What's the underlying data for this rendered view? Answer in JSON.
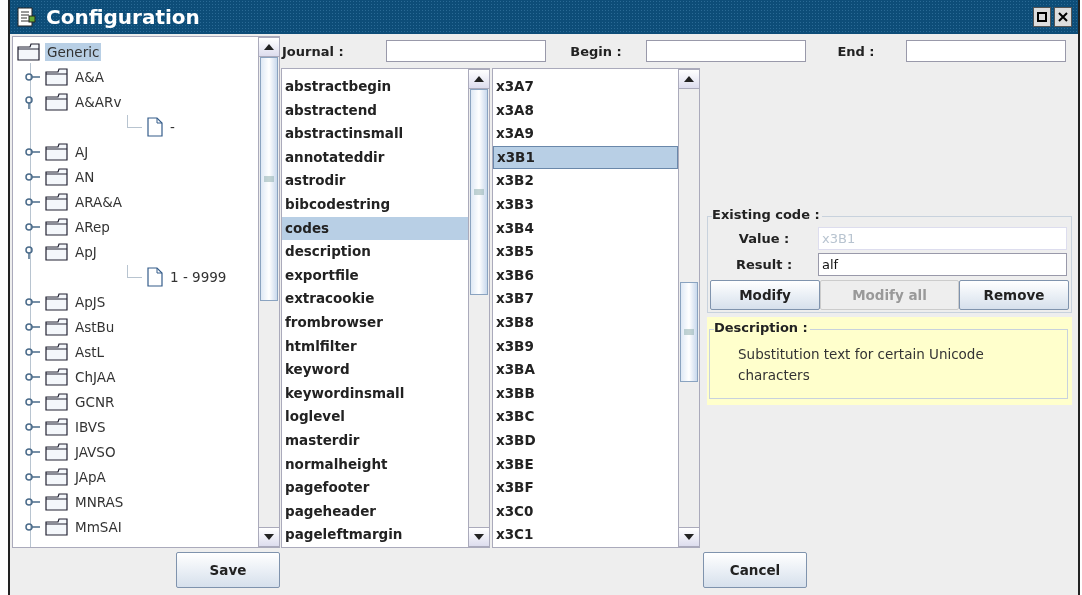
{
  "window": {
    "title": "Configuration"
  },
  "tree": {
    "label": "Generic",
    "kind": "folder",
    "selected": true,
    "children": [
      {
        "label": "A&A",
        "kind": "folder",
        "selected": false,
        "expanded": false
      },
      {
        "label": "A&ARv",
        "kind": "folder",
        "selected": false,
        "expanded": true,
        "children": [
          {
            "label": "-",
            "kind": "file",
            "selected": false
          }
        ]
      },
      {
        "label": "AJ",
        "kind": "folder",
        "selected": false,
        "expanded": false
      },
      {
        "label": "AN",
        "kind": "folder",
        "selected": false,
        "expanded": false
      },
      {
        "label": "ARA&A",
        "kind": "folder",
        "selected": false,
        "expanded": false
      },
      {
        "label": "ARep",
        "kind": "folder",
        "selected": false,
        "expanded": false
      },
      {
        "label": "ApJ",
        "kind": "folder",
        "selected": false,
        "expanded": true,
        "children": [
          {
            "label": "1 - 9999",
            "kind": "file",
            "selected": false
          }
        ]
      },
      {
        "label": "ApJS",
        "kind": "folder",
        "selected": false,
        "expanded": false
      },
      {
        "label": "AstBu",
        "kind": "folder",
        "selected": false,
        "expanded": false
      },
      {
        "label": "AstL",
        "kind": "folder",
        "selected": false,
        "expanded": false
      },
      {
        "label": "ChJAA",
        "kind": "folder",
        "selected": false,
        "expanded": false
      },
      {
        "label": "GCNR",
        "kind": "folder",
        "selected": false,
        "expanded": false
      },
      {
        "label": "IBVS",
        "kind": "folder",
        "selected": false,
        "expanded": false
      },
      {
        "label": "JAVSO",
        "kind": "folder",
        "selected": false,
        "expanded": false
      },
      {
        "label": "JApA",
        "kind": "folder",
        "selected": false,
        "expanded": false
      },
      {
        "label": "MNRAS",
        "kind": "folder",
        "selected": false,
        "expanded": false
      },
      {
        "label": "MmSAI",
        "kind": "folder",
        "selected": false,
        "expanded": false
      }
    ]
  },
  "filters": [
    {
      "label": "Journal :"
    },
    {
      "label": "Begin :"
    },
    {
      "label": "End :"
    }
  ],
  "keys": [
    {
      "label": "abstractbegin",
      "selected": false
    },
    {
      "label": "abstractend",
      "selected": false
    },
    {
      "label": "abstractinsmall",
      "selected": false
    },
    {
      "label": "annotateddir",
      "selected": false
    },
    {
      "label": "astrodir",
      "selected": false
    },
    {
      "label": "bibcodestring",
      "selected": false
    },
    {
      "label": "codes",
      "selected": true
    },
    {
      "label": "description",
      "selected": false
    },
    {
      "label": "exportfile",
      "selected": false
    },
    {
      "label": "extracookie",
      "selected": false
    },
    {
      "label": "frombrowser",
      "selected": false
    },
    {
      "label": "htmlfilter",
      "selected": false
    },
    {
      "label": "keyword",
      "selected": false
    },
    {
      "label": "keywordinsmall",
      "selected": false
    },
    {
      "label": "loglevel",
      "selected": false
    },
    {
      "label": "masterdir",
      "selected": false
    },
    {
      "label": "normalheight",
      "selected": false
    },
    {
      "label": "pagefooter",
      "selected": false
    },
    {
      "label": "pageheader",
      "selected": false
    },
    {
      "label": "pageleftmargin",
      "selected": false
    }
  ],
  "codes": [
    {
      "label": "x3A7",
      "selected": false
    },
    {
      "label": "x3A8",
      "selected": false
    },
    {
      "label": "x3A9",
      "selected": false
    },
    {
      "label": "x3B1",
      "selected": true
    },
    {
      "label": "x3B2",
      "selected": false
    },
    {
      "label": "x3B3",
      "selected": false
    },
    {
      "label": "x3B4",
      "selected": false
    },
    {
      "label": "x3B5",
      "selected": false
    },
    {
      "label": "x3B6",
      "selected": false
    },
    {
      "label": "x3B7",
      "selected": false
    },
    {
      "label": "x3B8",
      "selected": false
    },
    {
      "label": "x3B9",
      "selected": false
    },
    {
      "label": "x3BA",
      "selected": false
    },
    {
      "label": "x3BB",
      "selected": false
    },
    {
      "label": "x3BC",
      "selected": false
    },
    {
      "label": "x3BD",
      "selected": false
    },
    {
      "label": "x3BE",
      "selected": false
    },
    {
      "label": "x3BF",
      "selected": false
    },
    {
      "label": "x3C0",
      "selected": false
    },
    {
      "label": "x3C1",
      "selected": false
    }
  ],
  "existing_code": {
    "title": "Existing code :",
    "fields": [
      {
        "label": "Value :",
        "value": "x3B1",
        "disabled": true
      },
      {
        "label": "Result :",
        "value": "alf",
        "disabled": false
      }
    ],
    "buttons": [
      {
        "label": "Modify",
        "disabled": false
      },
      {
        "label": "Modify all",
        "disabled": true
      },
      {
        "label": "Remove",
        "disabled": false
      }
    ]
  },
  "description": {
    "title": "Description :",
    "text": "Substitution text for certain Unicode characters"
  },
  "footer_buttons": [
    {
      "label": "Save"
    },
    {
      "label": "Cancel"
    }
  ]
}
